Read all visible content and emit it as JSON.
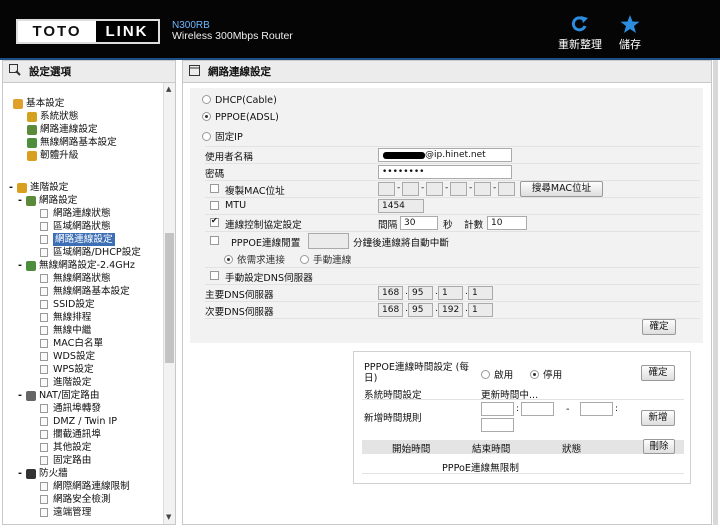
{
  "header": {
    "logo_left": "TOTO",
    "logo_right": "LINK",
    "model": "N300RB",
    "subtitle": "Wireless 300Mbps Router",
    "refresh_label": "重新整理",
    "bookmark_label": "儲存"
  },
  "sidebar": {
    "title": "設定選項",
    "items": [
      {
        "label": "基本設定"
      },
      {
        "label": "系統狀態"
      },
      {
        "label": "網路連線設定"
      },
      {
        "label": "無線網路基本設定"
      },
      {
        "label": "韌體升級"
      },
      {
        "label": "進階設定"
      },
      {
        "label": "網路設定"
      },
      {
        "label": "網路連線狀態"
      },
      {
        "label": "區域網路狀態"
      },
      {
        "label": "網路連線設定"
      },
      {
        "label": "區域網路/DHCP設定"
      },
      {
        "label": "無線網路設定-2.4GHz"
      },
      {
        "label": "無線網路狀態"
      },
      {
        "label": "無線網路基本設定"
      },
      {
        "label": "SSID設定"
      },
      {
        "label": "無線排程"
      },
      {
        "label": "無線中繼"
      },
      {
        "label": "MAC白名單"
      },
      {
        "label": "WDS設定"
      },
      {
        "label": "WPS設定"
      },
      {
        "label": "進階設定"
      },
      {
        "label": "NAT/固定路由"
      },
      {
        "label": "通訊埠轉發"
      },
      {
        "label": "DMZ / Twin IP"
      },
      {
        "label": "攔截通訊埠"
      },
      {
        "label": "其他設定"
      },
      {
        "label": "固定路由"
      },
      {
        "label": "防火牆"
      },
      {
        "label": "網際網路連線限制"
      },
      {
        "label": "網路安全檢測"
      },
      {
        "label": "遠端管理"
      }
    ]
  },
  "main": {
    "title": "網路連線設定",
    "modes": [
      "DHCP(Cable)",
      "PPPOE(ADSL)",
      "固定IP"
    ],
    "selected_mode": "PPPOE(ADSL)",
    "username_label": "使用者名稱",
    "username_value": "@ip.hinet.net",
    "password_label": "密碼",
    "password_value": "••••••••",
    "clone_mac_label": "複製MAC位址",
    "clone_mac_button": "搜尋MAC位址",
    "mtu_label": "MTU",
    "mtu_value": "1454",
    "keepalive_label": "連線控制協定設定",
    "interval_label": "間隔",
    "interval_value": "30",
    "interval_unit": "秒",
    "count_label": "計數",
    "count_value": "10",
    "idle_label": "PPPOE連線閒置",
    "idle_suffix": "分鐘後連線將自動中斷",
    "on_demand_label": "依需求連接",
    "manual_label": "手動連線",
    "manual_dns_label": "手動設定DNS伺服器",
    "dns1_label": "主要DNS伺服器",
    "dns1": [
      "168",
      "95",
      "1",
      "1"
    ],
    "dns2_label": "次要DNS伺服器",
    "dns2": [
      "168",
      "95",
      "192",
      "1"
    ],
    "apply_label": "確定"
  },
  "schedule": {
    "title": "PPPOE連線時間設定 (每日)",
    "enable_label": "啟用",
    "disable_label": "停用",
    "selected": "停用",
    "apply_label": "確定",
    "system_time_label": "系統時間設定",
    "system_time_value": "更新時間中...",
    "add_rule_label": "新增時間規則",
    "dash": "-",
    "add_button": "新增",
    "col_start": "開始時間",
    "col_end": "結束時間",
    "col_status": "狀態",
    "delete_button": "刪除",
    "empty_text": "PPPoE連線無限制"
  }
}
